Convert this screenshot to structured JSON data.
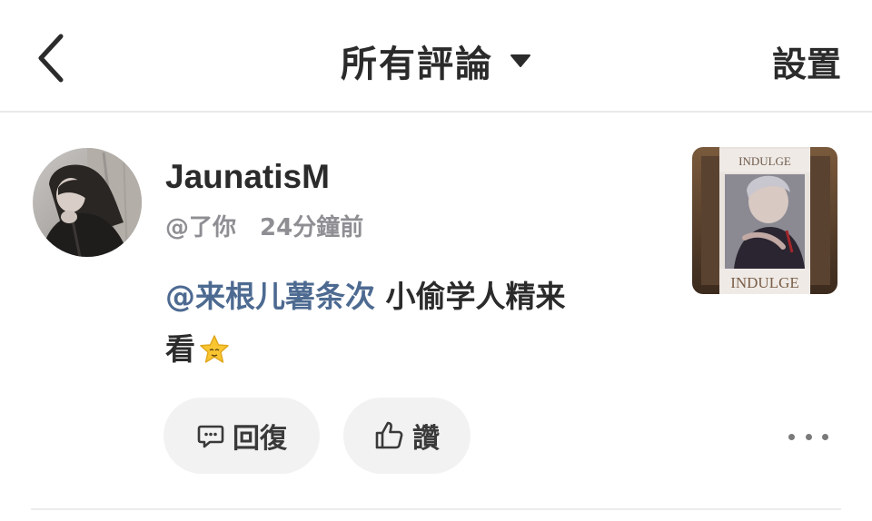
{
  "header": {
    "title": "所有評論",
    "settings_label": "設置"
  },
  "comment": {
    "author_name": "JaunatisM",
    "handle": "@了你",
    "time_ago": "24分鐘前",
    "mention": "@来根儿薯条次",
    "text_part1": " 小偷学人精来",
    "text_part2": "看",
    "emoji": "star-face-emoji",
    "thumbnail": {
      "caption_top": "INDULGE",
      "caption_bottom": "INDULGE"
    },
    "actions": {
      "reply_label": "回復",
      "like_label": "讚"
    }
  },
  "colors": {
    "mention": "#4d6a91",
    "meta": "#8e8e93",
    "pill_bg": "#f2f2f2"
  }
}
